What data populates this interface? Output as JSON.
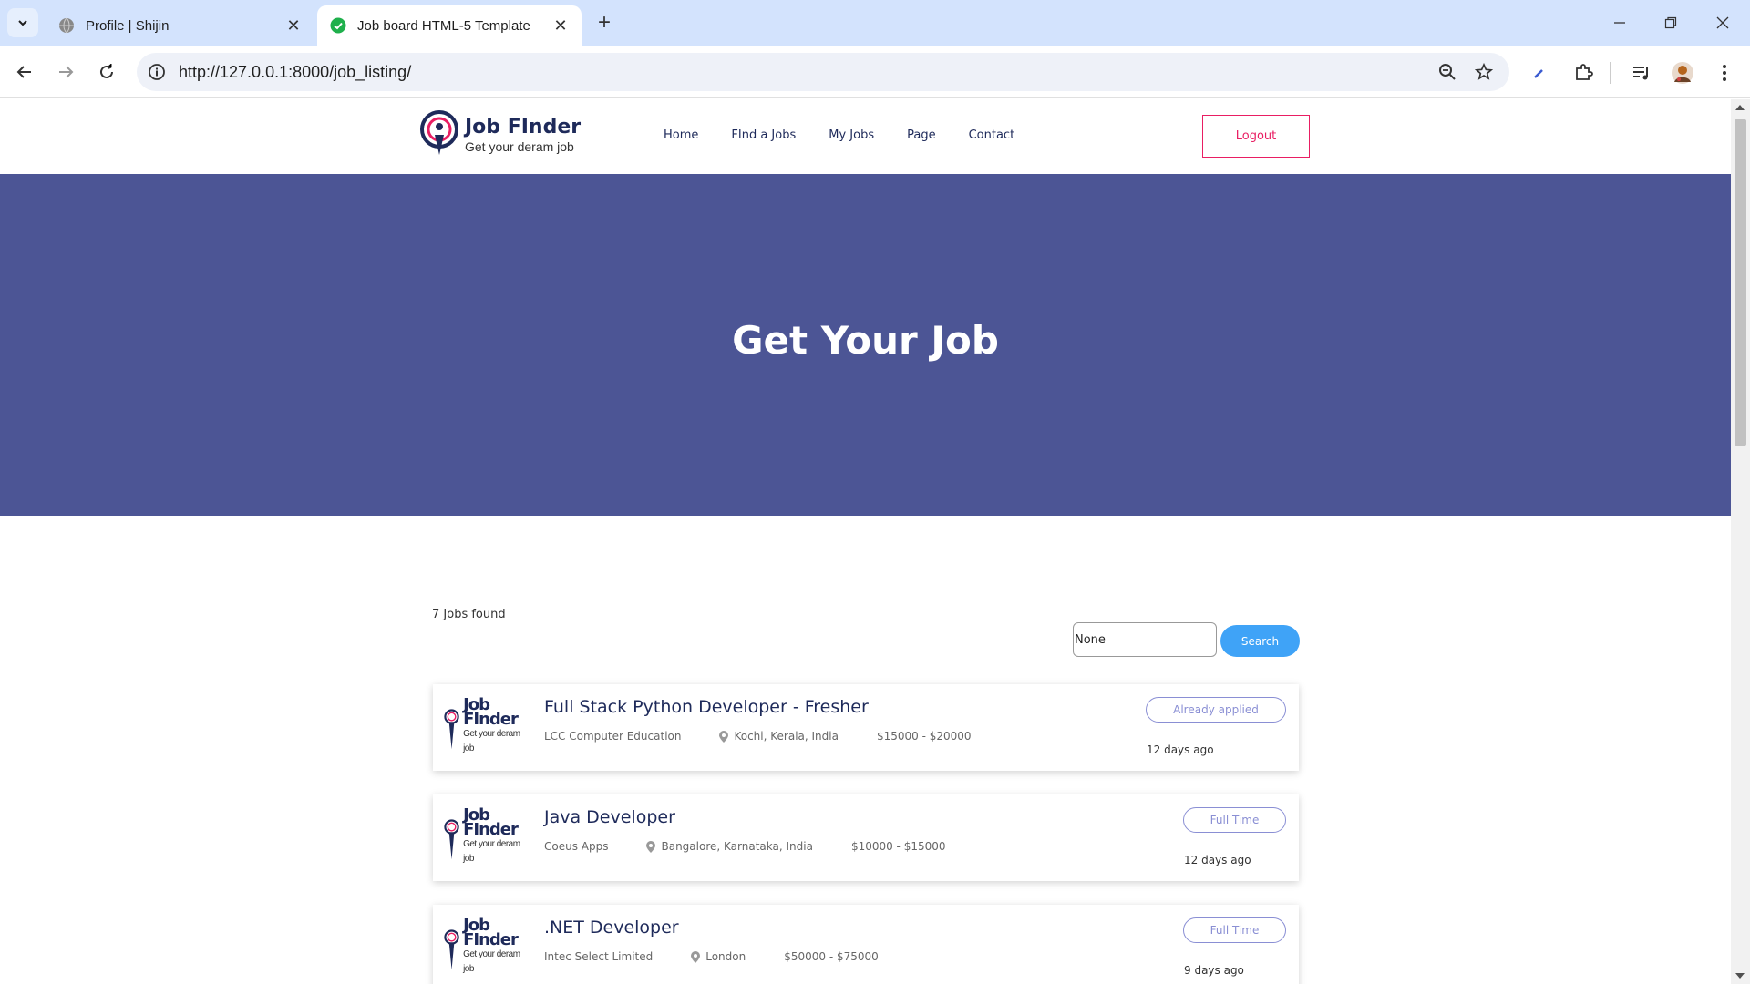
{
  "browser": {
    "tabs": [
      {
        "title": "Profile | Shijin",
        "active": false
      },
      {
        "title": "Job board HTML-5 Template",
        "active": true
      }
    ],
    "url": "http://127.0.0.1:8000/job_listing/"
  },
  "site": {
    "logo_name": "Job FInder",
    "logo_tagline": "Get your deram job",
    "nav": [
      "Home",
      "FInd a Jobs",
      "My Jobs",
      "Page",
      "Contact"
    ],
    "logout_label": "Logout"
  },
  "hero": {
    "title": "Get Your Job",
    "bg_color": "#4c5595"
  },
  "listing": {
    "count_text": "7 Jobs found",
    "search_value": "None",
    "search_label": "Search",
    "jobs": [
      {
        "title": "Full Stack Python Developer - Fresher",
        "company": "LCC Computer Education",
        "location": "Kochi, Kerala, India",
        "salary": "$15000 - $20000",
        "badge": "Already applied",
        "posted": "12 days ago"
      },
      {
        "title": "Java Developer",
        "company": "Coeus Apps",
        "location": "Bangalore, Karnataka, India",
        "salary": "$10000 - $15000",
        "badge": "Full Time",
        "posted": "12 days ago"
      },
      {
        "title": ".NET Developer",
        "company": "Intec Select Limited",
        "location": "London",
        "salary": "$50000 - $75000",
        "badge": "Full Time",
        "posted": "9 days ago"
      }
    ]
  },
  "colors": {
    "accent_pink": "#e91e63",
    "search_blue": "#3fa3f7",
    "badge_purple": "#8a8fd4",
    "navy": "#1e2a5a"
  },
  "icons": {
    "tab_search": "chevron-down-icon",
    "location": "map-pin-icon"
  }
}
